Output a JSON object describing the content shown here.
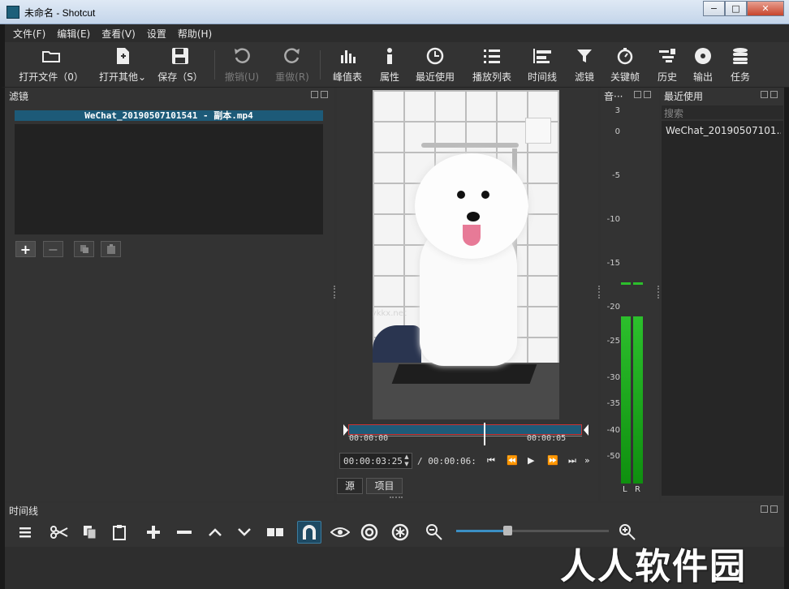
{
  "window": {
    "title": "未命名 - Shotcut",
    "controls": [
      "−",
      "□",
      "✕"
    ]
  },
  "menu": [
    "文件(F)",
    "编辑(E)",
    "查看(V)",
    "设置",
    "帮助(H)"
  ],
  "toolbar": {
    "open_file": "打开文件（0）",
    "open_other": "打开其他",
    "save": "保存（S）",
    "undo": "撤销(U)",
    "redo": "重做(R)",
    "peak_meter": "峰值表",
    "properties": "属性",
    "recent": "最近使用",
    "playlist": "播放列表",
    "timeline": "时间线",
    "filters": "滤镜",
    "keyframes": "关键帧",
    "history": "历史",
    "export": "输出",
    "jobs": "任务"
  },
  "filters_panel": {
    "title": "滤镜",
    "clip_name": "WeChat_20190507101541 - 副本.mp4"
  },
  "player": {
    "scrub_start": "00:00:00",
    "scrub_end": "00:00:05",
    "position_fraction": 0.58,
    "timecode": "00:00:03:25",
    "duration": "/ 00:00:06:",
    "tab_source": "源",
    "tab_project": "项目",
    "video_watermark": "www.ykkx.net"
  },
  "meter": {
    "title": "音···",
    "scale": [
      "3",
      "0",
      "-5",
      "-10",
      "-15",
      "-20",
      "-25",
      "-30",
      "-35",
      "-40",
      "-50"
    ],
    "left_label": "L",
    "right_label": "R"
  },
  "recent_panel": {
    "title": "最近使用",
    "search_placeholder": "搜索",
    "items": [
      "WeChat_20190507101..."
    ]
  },
  "timeline_panel": {
    "title": "时间线"
  },
  "overlay_watermark": "人人软件园",
  "colors": {
    "accent": "#1d5a78",
    "meter_green": "#2cbf2c",
    "mark_red": "#cc3333"
  }
}
